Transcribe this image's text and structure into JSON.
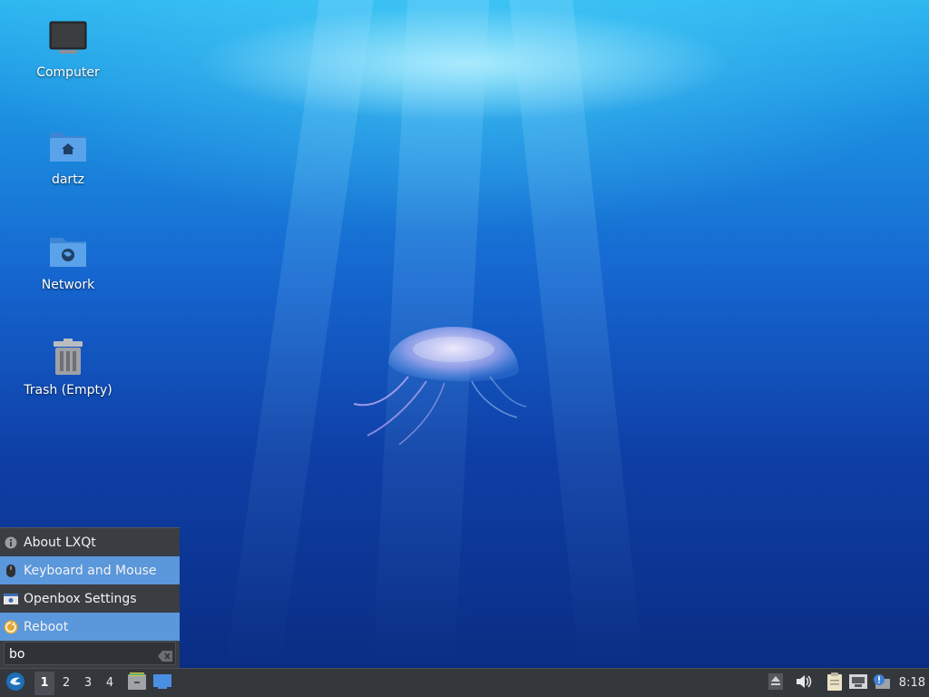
{
  "desktop": {
    "icons": [
      {
        "label": "Computer",
        "icon": "computer-icon"
      },
      {
        "label": "dartz",
        "icon": "home-folder-icon"
      },
      {
        "label": "Network",
        "icon": "network-folder-icon"
      },
      {
        "label": "Trash (Empty)",
        "icon": "trash-icon"
      }
    ]
  },
  "menu": {
    "items": [
      {
        "label": "About LXQt",
        "icon": "info-icon",
        "highlighted": false
      },
      {
        "label": "Keyboard and Mouse",
        "icon": "mouse-icon",
        "highlighted": true
      },
      {
        "label": "Openbox Settings",
        "icon": "openbox-icon",
        "highlighted": false
      },
      {
        "label": "Reboot",
        "icon": "reboot-icon",
        "highlighted": true
      }
    ],
    "search": {
      "value": "bo",
      "placeholder": ""
    }
  },
  "taskbar": {
    "workspaces": [
      "1",
      "2",
      "3",
      "4"
    ],
    "active_workspace": "1",
    "clock": "8:18",
    "tray_icons": [
      "eject-icon",
      "volume-icon",
      "clipboard-icon",
      "network-icon",
      "notification-icon"
    ]
  },
  "colors": {
    "highlight": "#5a97db",
    "panel": "#34373c",
    "menu_bg": "#3a3d42"
  }
}
